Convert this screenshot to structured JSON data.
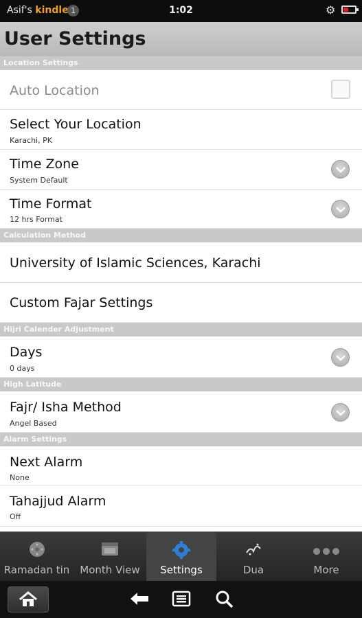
{
  "status_bar": {
    "owner": "Asif's",
    "device": "kindle",
    "badge": "1",
    "time": "1:02"
  },
  "header": {
    "title": "User Settings"
  },
  "sections": {
    "location": {
      "header": "Location Settings",
      "auto_location": {
        "label": "Auto Location",
        "checked": false
      },
      "select_location": {
        "label": "Select Your Location",
        "value": "Karachi, PK"
      },
      "time_zone": {
        "label": "Time Zone",
        "value": "System Default"
      },
      "time_format": {
        "label": "Time Format",
        "value": "12 hrs Format"
      }
    },
    "calculation": {
      "header": "Calculation Method",
      "method": {
        "label": "University of Islamic Sciences, Karachi"
      },
      "custom_fajar": {
        "label": "Custom Fajar Settings"
      }
    },
    "hijri": {
      "header": "Hijri Calender Adjustment",
      "days": {
        "label": "Days",
        "value": "0 days"
      }
    },
    "high_latitude": {
      "header": "High Latitude",
      "method": {
        "label": "Fajr/ Isha Method",
        "value": "Angel Based"
      }
    },
    "alarm": {
      "header": "Alarm Settings",
      "next_alarm": {
        "label": "Next Alarm",
        "value": "None"
      },
      "tahajjud": {
        "label": "Tahajjud Alarm",
        "value": "Off"
      }
    }
  },
  "tabs": [
    {
      "label": "Ramadan tin",
      "icon": "ramadan-icon"
    },
    {
      "label": "Month View",
      "icon": "calendar-icon"
    },
    {
      "label": "Settings",
      "icon": "settings-icon",
      "active": true
    },
    {
      "label": "Dua",
      "icon": "quran-icon"
    },
    {
      "label": "More",
      "icon": "more-icon"
    }
  ],
  "nav": {
    "icons": [
      "home-icon",
      "back-icon",
      "menu-icon",
      "search-icon"
    ]
  },
  "colors": {
    "kindle_orange": "#f0a020",
    "battery_red": "#e02020",
    "section_gray": "#c9c9c9"
  }
}
